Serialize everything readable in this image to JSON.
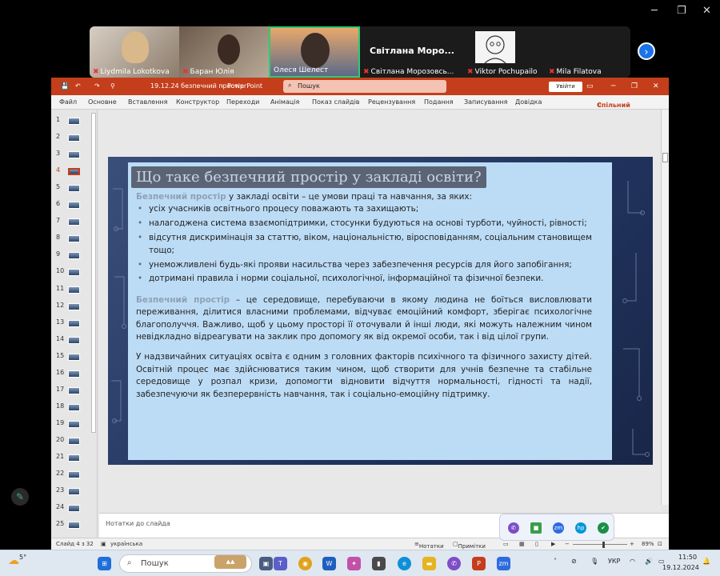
{
  "zoom": {
    "participants": [
      {
        "name": "Liydmila Lokotkova"
      },
      {
        "name": "Баран Юлія"
      },
      {
        "name": "Олеся Шелест"
      },
      {
        "name": "Світлана Морозовсь...",
        "big_label": "Світлана  Моро..."
      },
      {
        "name": "Viktor Pochupailo"
      },
      {
        "name": "Mila Filatova"
      }
    ],
    "next_icon": "chevron-right-icon",
    "window_controls": [
      "─",
      "❐",
      "✕"
    ]
  },
  "ppt": {
    "filename": "19.12.24 безпечний простір",
    "app": "PowerPoint",
    "search_placeholder": "Пошук",
    "sign_in": "Увійти",
    "menu": [
      "Файл",
      "Основне",
      "Вставлення",
      "Конструктор",
      "Переходи",
      "Анімація",
      "Показ слайдів",
      "Рецензування",
      "Подання",
      "Записування",
      "Довідка"
    ],
    "share": "Спільний доступ",
    "active_slide": 4,
    "notes_placeholder": "Нотатки до слайда",
    "status": {
      "slide_info": "Слайд 4 з 32",
      "language": "українська",
      "notes_btn": "Нотатки",
      "comments_btn": "Примітки",
      "zoom": "89%"
    },
    "slide": {
      "title": "Що таке безпечний простір у закладі освіти?",
      "intro_term": "Безпечний простір",
      "intro_rest": " у закладі освіти – це умови праці та навчання, за яких:",
      "bullets": [
        "усіх учасників освітнього процесу поважають та захищають;",
        "налагоджена система взаємопідтримки, стосунки будуються на основі турботи, чуйності, рівності;",
        "відсутня дискримінація за статтю, віком, національністю, віросповіданням, соціальним становищем тощо;",
        "унеможливлені будь-які прояви насильства через забезпечення ресурсів для його запобігання;",
        "дотримані правила і норми соціальної, психологічної, інформаційної та фізичної безпеки."
      ],
      "para2_term": "Безпечний простір",
      "para2_rest": " – це середовище, перебуваючи в якому людина не боїться висловлювати переживання, ділитися власними проблемами, відчуває емоційний комфорт, зберігає психологічне благополуччя. Важливо, щоб у цьому просторі її оточували й інші люди, які можуть належним чином невідкладно відреагувати на заклик про допомогу як від окремої особи, так і від цілої групи.",
      "para3": "У надзвичайних ситуаціях освіта є одним з головних факторів психічного та фізичного захисту дітей. Освітній процес має здійснюватися таким чином, щоб створити для учнів безпечне та стабільне середовище у розпал кризи, допомогти відновити відчуття нормальності, гідності та надії, забезпечуючи як безперервність навчання, так і соціально-емоційну підтримку."
    }
  },
  "taskbar": {
    "weather": "5°",
    "search": "Пошук",
    "lang": "УКР",
    "time": "11:50",
    "date": "19.12.2024"
  },
  "colors": {
    "ppt_red": "#c43e1c",
    "slide_panel": "#bcdcf6",
    "slide_bg": "#21335d",
    "zoom_active": "#2ecc71"
  }
}
